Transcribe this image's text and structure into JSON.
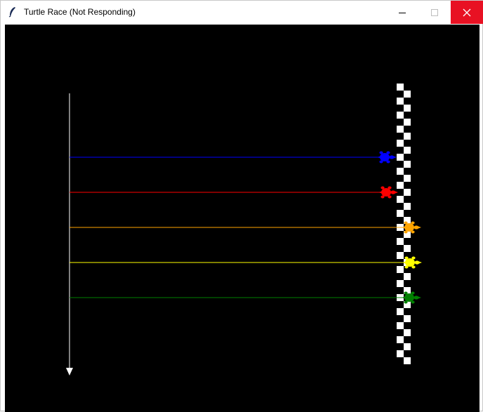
{
  "window": {
    "title": "Turtle Race (Not Responding)",
    "controls": [
      "minimize",
      "maximize",
      "close"
    ],
    "close_color": "#e81123"
  },
  "race": {
    "background": "#000000",
    "track_line_color": "#ffffff",
    "finish_pattern": "black-white-checkered",
    "turtles": [
      {
        "color": "blue",
        "hex": "#0000ff"
      },
      {
        "color": "red",
        "hex": "#ff0000"
      },
      {
        "color": "orange",
        "hex": "#ffa500"
      },
      {
        "color": "yellow",
        "hex": "#ffff00"
      },
      {
        "color": "green",
        "hex": "#008000"
      }
    ]
  }
}
